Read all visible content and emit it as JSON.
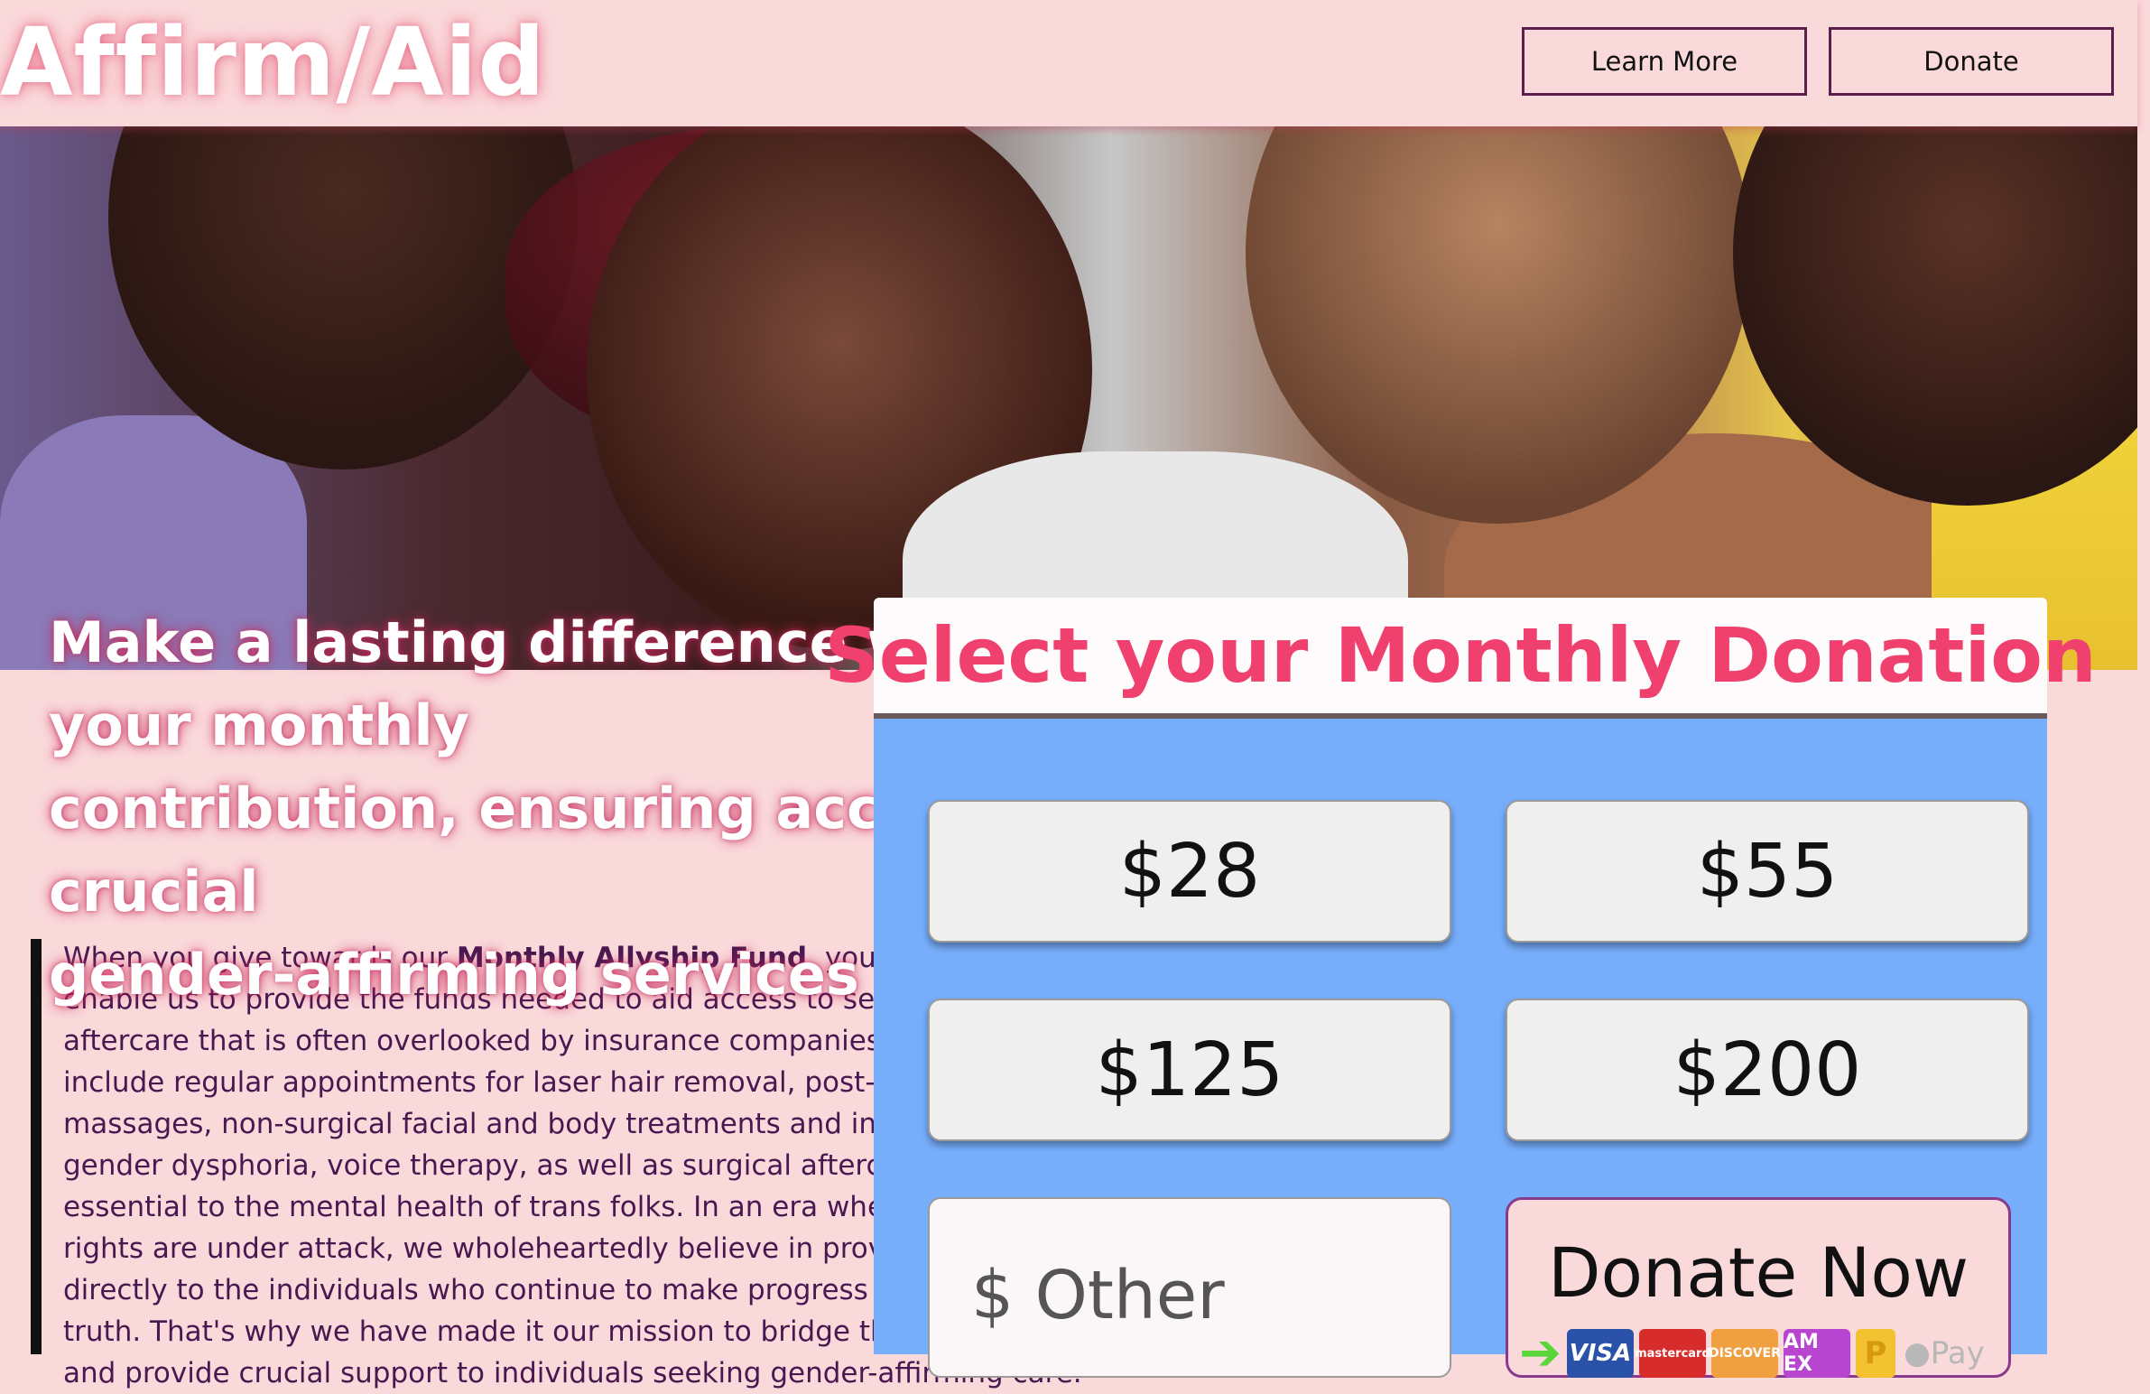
{
  "header": {
    "logo": "Affirm/Aid",
    "learn_more": "Learn More",
    "donate": "Donate"
  },
  "hero": {
    "line1": "Make a lasting difference with your monthly",
    "line2": "contribution, ensuring access to crucial",
    "line3": "gender-affirming services"
  },
  "description": {
    "intro": "When you give towards our ",
    "fund_name": "Monthly Allyship Fund",
    "body": ", you will directly enable us to provide the funds needed to aid access to services and aftercare that is often overlooked by insurance companies. Such essentials include regular appointments for laser hair removal, post-op lymphatic massages, non-surgical facial and body treatments and injections for gender dysphoria, voice therapy, as well as surgical aftercare supplies: all essential to the mental health of trans folks. In an era where Trans folks rights are under attack, we wholeheartedly believe in providing support directly to the individuals who continue to make progress and live in their truth. That's why we have made it our mission to bridge the financial gap and provide crucial support to individuals seeking gender-affirming care."
  },
  "donation": {
    "title": "Select your Monthly Donation",
    "amounts": [
      "$28",
      "$55",
      "$125",
      "$200"
    ],
    "other_placeholder": "$ Other",
    "donate_now": "Donate Now",
    "payment_methods": [
      "VISA",
      "mastercard",
      "DISCOVER",
      "AM EX",
      "P",
      "Pay"
    ]
  },
  "colors": {
    "background": "#fad9db",
    "accent": "#f0406e",
    "panel": "#77aefc",
    "text_purple": "#4a1850"
  }
}
